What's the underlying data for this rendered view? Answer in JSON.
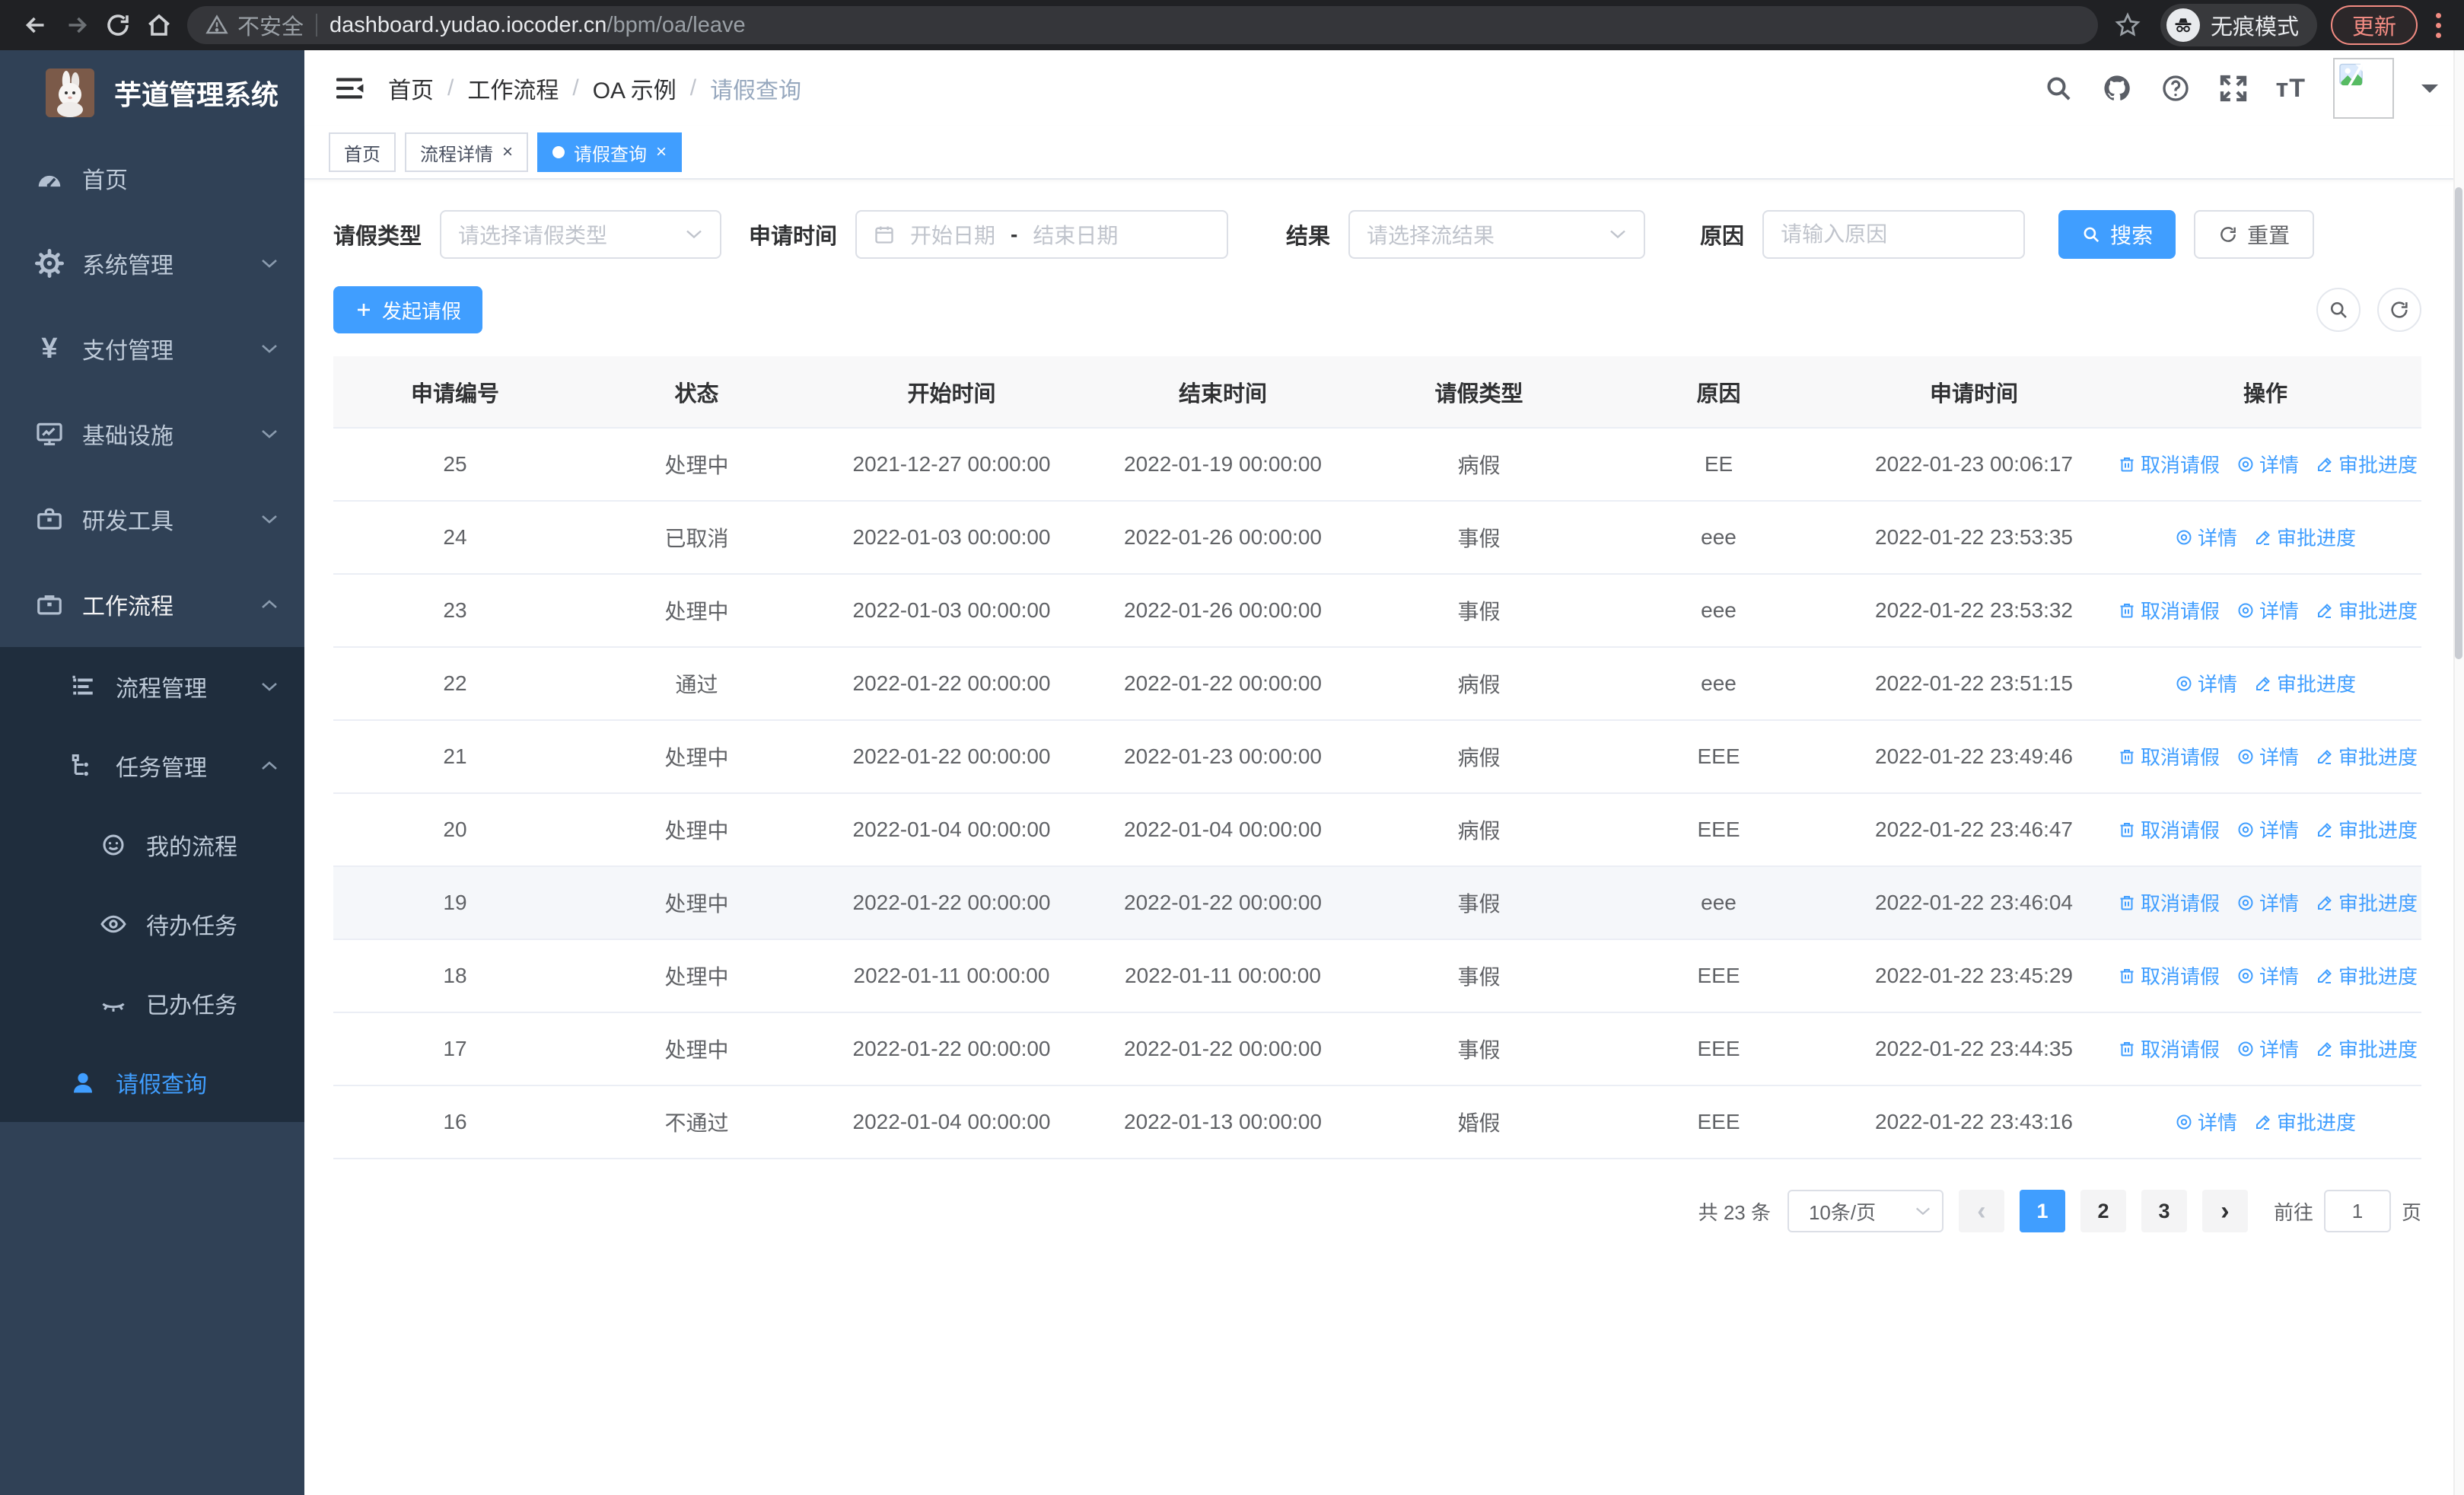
{
  "browser": {
    "security_label": "不安全",
    "url_host": "dashboard.yudao.iocoder.cn",
    "url_path": "/bpm/oa/leave",
    "incognito_label": "无痕模式",
    "update_label": "更新"
  },
  "sidebar": {
    "logo_title": "芋道管理系统",
    "items": [
      {
        "label": "首页"
      },
      {
        "label": "系统管理"
      },
      {
        "label": "支付管理",
        "icon_glyph": "¥"
      },
      {
        "label": "基础设施"
      },
      {
        "label": "研发工具"
      },
      {
        "label": "工作流程"
      }
    ],
    "workflow_children": [
      {
        "label": "流程管理"
      },
      {
        "label": "任务管理"
      }
    ],
    "task_children": [
      {
        "label": "我的流程"
      },
      {
        "label": "待办任务"
      },
      {
        "label": "已办任务"
      }
    ],
    "leave_item": {
      "label": "请假查询"
    }
  },
  "header": {
    "breadcrumb": [
      "首页",
      "工作流程",
      "OA 示例",
      "请假查询"
    ],
    "breadcrumb_separator": "/",
    "font_size_glyph": "тT"
  },
  "tabs": [
    {
      "label": "首页",
      "closable": false,
      "active": false
    },
    {
      "label": "流程详情",
      "closable": true,
      "active": false
    },
    {
      "label": "请假查询",
      "closable": true,
      "active": true
    }
  ],
  "tab_close_glyph": "×",
  "filters": {
    "leave_type_label": "请假类型",
    "leave_type_placeholder": "请选择请假类型",
    "apply_time_label": "申请时间",
    "start_date_placeholder": "开始日期",
    "range_separator": "-",
    "end_date_placeholder": "结束日期",
    "result_label": "结果",
    "result_placeholder": "请选择流结果",
    "reason_label": "原因",
    "reason_placeholder": "请输入原因",
    "search_button": "搜索",
    "reset_button": "重置"
  },
  "toolbar": {
    "create_button": "发起请假"
  },
  "table": {
    "columns": [
      "申请编号",
      "状态",
      "开始时间",
      "结束时间",
      "请假类型",
      "原因",
      "申请时间",
      "操作"
    ],
    "action_labels": {
      "cancel": "取消请假",
      "detail": "详情",
      "progress": "审批进度"
    },
    "rows": [
      {
        "id": "25",
        "status": "处理中",
        "start": "2021-12-27 00:00:00",
        "end": "2022-01-19 00:00:00",
        "type": "病假",
        "reason": "EE",
        "applied": "2022-01-23 00:06:17",
        "actions": [
          "cancel",
          "detail",
          "progress"
        ],
        "highlight": false
      },
      {
        "id": "24",
        "status": "已取消",
        "start": "2022-01-03 00:00:00",
        "end": "2022-01-26 00:00:00",
        "type": "事假",
        "reason": "eee",
        "applied": "2022-01-22 23:53:35",
        "actions": [
          "detail",
          "progress"
        ],
        "highlight": false
      },
      {
        "id": "23",
        "status": "处理中",
        "start": "2022-01-03 00:00:00",
        "end": "2022-01-26 00:00:00",
        "type": "事假",
        "reason": "eee",
        "applied": "2022-01-22 23:53:32",
        "actions": [
          "cancel",
          "detail",
          "progress"
        ],
        "highlight": false
      },
      {
        "id": "22",
        "status": "通过",
        "start": "2022-01-22 00:00:00",
        "end": "2022-01-22 00:00:00",
        "type": "病假",
        "reason": "eee",
        "applied": "2022-01-22 23:51:15",
        "actions": [
          "detail",
          "progress"
        ],
        "highlight": false
      },
      {
        "id": "21",
        "status": "处理中",
        "start": "2022-01-22 00:00:00",
        "end": "2022-01-23 00:00:00",
        "type": "病假",
        "reason": "EEE",
        "applied": "2022-01-22 23:49:46",
        "actions": [
          "cancel",
          "detail",
          "progress"
        ],
        "highlight": false
      },
      {
        "id": "20",
        "status": "处理中",
        "start": "2022-01-04 00:00:00",
        "end": "2022-01-04 00:00:00",
        "type": "病假",
        "reason": "EEE",
        "applied": "2022-01-22 23:46:47",
        "actions": [
          "cancel",
          "detail",
          "progress"
        ],
        "highlight": false
      },
      {
        "id": "19",
        "status": "处理中",
        "start": "2022-01-22 00:00:00",
        "end": "2022-01-22 00:00:00",
        "type": "事假",
        "reason": "eee",
        "applied": "2022-01-22 23:46:04",
        "actions": [
          "cancel",
          "detail",
          "progress"
        ],
        "highlight": true
      },
      {
        "id": "18",
        "status": "处理中",
        "start": "2022-01-11 00:00:00",
        "end": "2022-01-11 00:00:00",
        "type": "事假",
        "reason": "EEE",
        "applied": "2022-01-22 23:45:29",
        "actions": [
          "cancel",
          "detail",
          "progress"
        ],
        "highlight": false
      },
      {
        "id": "17",
        "status": "处理中",
        "start": "2022-01-22 00:00:00",
        "end": "2022-01-22 00:00:00",
        "type": "事假",
        "reason": "EEE",
        "applied": "2022-01-22 23:44:35",
        "actions": [
          "cancel",
          "detail",
          "progress"
        ],
        "highlight": false
      },
      {
        "id": "16",
        "status": "不通过",
        "start": "2022-01-04 00:00:00",
        "end": "2022-01-13 00:00:00",
        "type": "婚假",
        "reason": "EEE",
        "applied": "2022-01-22 23:43:16",
        "actions": [
          "detail",
          "progress"
        ],
        "highlight": false
      }
    ]
  },
  "pagination": {
    "total_text": "共 23 条",
    "page_size_label": "10条/页",
    "prev_glyph": "‹",
    "next_glyph": "›",
    "pages": [
      "1",
      "2",
      "3"
    ],
    "active_page": "1",
    "goto_label": "前往",
    "goto_value": "1",
    "page_unit": "页"
  },
  "colors": {
    "primary": "#409eff",
    "sidebar_bg": "#304156",
    "submenu_bg": "#1f2d3d",
    "chrome_accent": "#f28b82"
  }
}
